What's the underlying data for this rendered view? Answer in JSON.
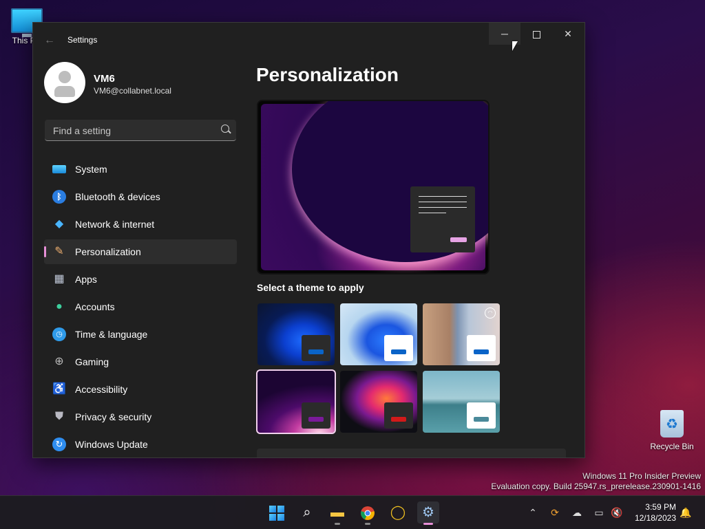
{
  "desktop": {
    "this_pc_label": "This PC",
    "recycle_bin_label": "Recycle Bin",
    "watermark": {
      "line1": "Windows 11 Pro Insider Preview",
      "line2": "Evaluation copy. Build 25947.rs_prerelease.230901-1416"
    }
  },
  "window": {
    "title": "Settings",
    "back_icon": "arrow-left-icon",
    "minimize_icon": "minimize-icon",
    "maximize_icon": "maximize-icon",
    "close_icon": "close-icon"
  },
  "profile": {
    "name": "VM6",
    "email": "VM6@collabnet.local"
  },
  "search": {
    "placeholder": "Find a setting"
  },
  "nav": {
    "items": [
      {
        "label": "System",
        "icon": "system-icon"
      },
      {
        "label": "Bluetooth & devices",
        "icon": "bluetooth-icon"
      },
      {
        "label": "Network & internet",
        "icon": "wifi-icon"
      },
      {
        "label": "Personalization",
        "icon": "brush-icon",
        "selected": true
      },
      {
        "label": "Apps",
        "icon": "apps-icon"
      },
      {
        "label": "Accounts",
        "icon": "person-icon"
      },
      {
        "label": "Time & language",
        "icon": "globe-clock-icon"
      },
      {
        "label": "Gaming",
        "icon": "gamepad-icon"
      },
      {
        "label": "Accessibility",
        "icon": "accessibility-icon"
      },
      {
        "label": "Privacy & security",
        "icon": "shield-icon"
      },
      {
        "label": "Windows Update",
        "icon": "update-icon"
      }
    ]
  },
  "content": {
    "title": "Personalization",
    "themes_heading": "Select a theme to apply",
    "themes": [
      {
        "name": "windows-dark",
        "accent": "#0a64c8",
        "mini_bg": "#2b2b2b"
      },
      {
        "name": "windows-light",
        "accent": "#0a64c8",
        "mini_bg": "#ffffff"
      },
      {
        "name": "spotlight",
        "accent": "#0a64c8",
        "mini_bg": "#ffffff"
      },
      {
        "name": "glow",
        "accent": "#7a1a9a",
        "mini_bg": "#2b2b2b",
        "selected": true
      },
      {
        "name": "captured-motion",
        "accent": "#d11a1a",
        "mini_bg": "#2b2b2b"
      },
      {
        "name": "flow",
        "accent": "#4a8a9a",
        "mini_bg": "#ffffff"
      }
    ]
  },
  "taskbar": {
    "apps": [
      {
        "name": "start",
        "icon": "windows-logo-icon"
      },
      {
        "name": "search",
        "icon": "search-icon"
      },
      {
        "name": "file-explorer",
        "icon": "folder-icon"
      },
      {
        "name": "chrome",
        "icon": "chrome-icon"
      },
      {
        "name": "ring-app",
        "icon": "ring-icon"
      },
      {
        "name": "settings",
        "icon": "gear-icon",
        "active": true
      }
    ],
    "tray_icons": [
      "chevron-up-icon",
      "sync-icon",
      "cloud-off-icon",
      "network-icon",
      "volume-mute-icon"
    ],
    "time": "3:59 PM",
    "date": "12/18/2023",
    "notification_icon": "bell-icon"
  },
  "colors": {
    "accent": "#e78fd7",
    "window_bg": "#202020",
    "selected_nav_bg": "#2d2d2d"
  }
}
